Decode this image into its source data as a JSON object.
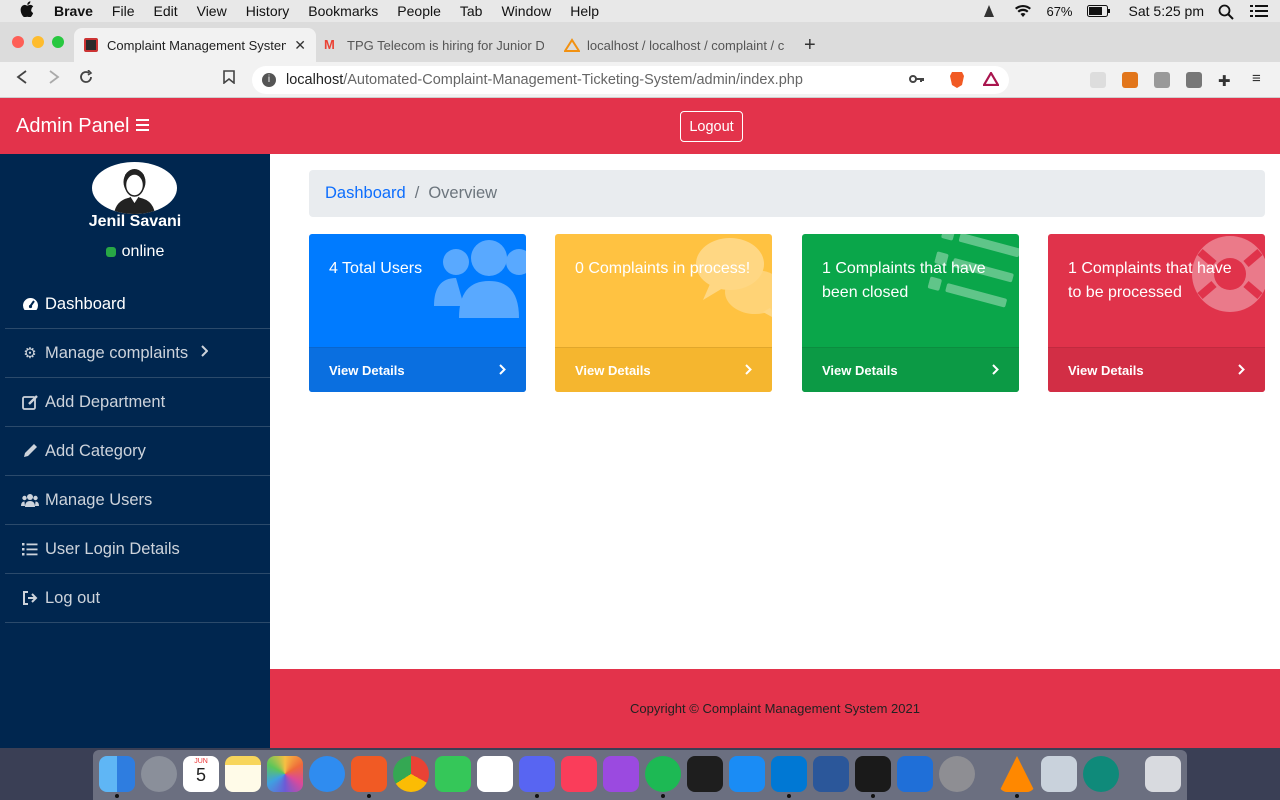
{
  "menubar": {
    "app_name": "Brave",
    "items": [
      "File",
      "Edit",
      "View",
      "History",
      "Bookmarks",
      "People",
      "Tab",
      "Window",
      "Help"
    ],
    "battery": "67%",
    "clock": "Sat 5:25 pm"
  },
  "browser": {
    "tabs": [
      {
        "title": "Complaint Management System",
        "favicon_color": "#2b2b2b"
      },
      {
        "title": "TPG Telecom is hiring for Junior Dev",
        "favicon_color": "#ea4335"
      },
      {
        "title": "localhost / localhost / complaint / cl",
        "favicon_color": "#f29111"
      }
    ],
    "url_host": "localhost",
    "url_path": "/Automated-Complaint-Management-Ticketing-System/admin/index.php"
  },
  "header": {
    "brand": "Admin Panel",
    "logout_label": "Logout",
    "accent": "#e3334b"
  },
  "sidebar": {
    "user_name": "Jenil Savani",
    "user_status": "online",
    "items": [
      {
        "label": "Dashboard",
        "icon": "tachometer-icon"
      },
      {
        "label": "Manage complaints",
        "icon": "gear-icon"
      },
      {
        "label": "Add Department",
        "icon": "edit-icon"
      },
      {
        "label": "Add Category",
        "icon": "pencil-icon"
      },
      {
        "label": "Manage Users",
        "icon": "users-icon"
      },
      {
        "label": "User Login Details",
        "icon": "list-icon"
      },
      {
        "label": "Log out",
        "icon": "sign-out-icon"
      }
    ],
    "bg_color": "#00264f"
  },
  "breadcrumb": {
    "link": "Dashboard",
    "separator": "/",
    "current": "Overview"
  },
  "cards": [
    {
      "text": "4 Total Users",
      "footer": "View Details",
      "color": "#007bff"
    },
    {
      "text": "0 Complaints in process!",
      "footer": "View Details",
      "color": "#ffc241"
    },
    {
      "text": "1 Complaints that have been closed",
      "footer": "View Details",
      "color": "#0aa64a"
    },
    {
      "text": "1 Complaints that have to be processed",
      "footer": "View Details",
      "color": "#e0334b"
    }
  ],
  "footer": {
    "copyright": "Copyright © Complaint Management System 2021"
  },
  "dock": {
    "calendar_month": "JUN",
    "calendar_day": "5",
    "apps": [
      "finder",
      "launchpad",
      "calendar",
      "notes",
      "photos",
      "safari",
      "brave",
      "chrome",
      "facetime",
      "slack",
      "discord",
      "music",
      "podcasts",
      "spotify",
      "figma",
      "app-store",
      "vscode",
      "word",
      "terminal",
      "xcode",
      "system-preferences",
      "vlc",
      "utility",
      "brain-app",
      "trash"
    ]
  }
}
